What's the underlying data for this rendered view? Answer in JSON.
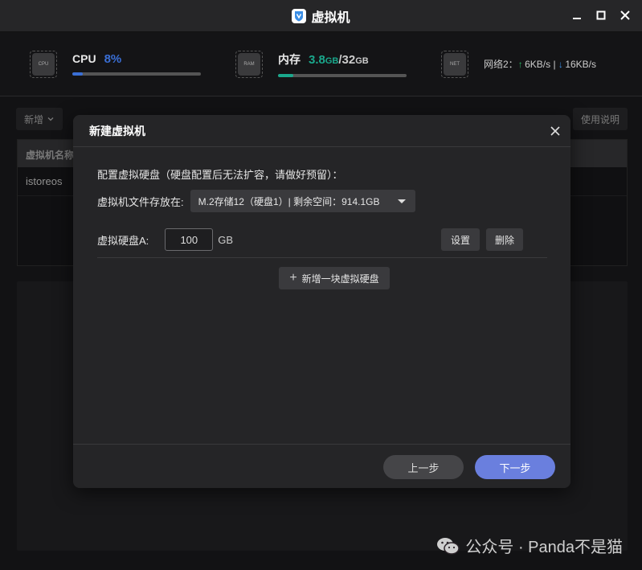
{
  "window": {
    "title": "虚拟机"
  },
  "stats": {
    "cpu": {
      "chip": "CPU",
      "label": "CPU",
      "value": "8%",
      "fraction": 0.08,
      "color": "#3a6fd6"
    },
    "mem": {
      "chip": "RAM",
      "label": "内存",
      "used": "3.8",
      "used_unit": "GB",
      "sep": "/",
      "total": "32",
      "total_unit": "GB",
      "fraction": 0.12,
      "color": "#1aa88c"
    },
    "net": {
      "chip": "NET",
      "label": "网络2：",
      "up_arrow": "↑",
      "up": "6KB/s",
      "sep": " | ",
      "down_arrow": "↓",
      "down": "16KB/s"
    }
  },
  "toolbar": {
    "new_label": "新增",
    "help_label": "使用说明"
  },
  "table": {
    "header_first": "虚拟机名称",
    "rows": [
      {
        "name": "istoreos"
      }
    ]
  },
  "dialog": {
    "title": "新建虚拟机",
    "intro": "配置虚拟硬盘（硬盘配置后无法扩容，请做好预留）：",
    "location_label": "虚拟机文件存放在:",
    "location_value": "M.2存储12（硬盘1）| 剩余空间：914.1GB",
    "disk_label": "虚拟硬盘A:",
    "disk_size": "100",
    "disk_unit": "GB",
    "settings_label": "设置",
    "delete_label": "删除",
    "add_disk_label": "新增一块虚拟硬盘",
    "prev_label": "上一步",
    "next_label": "下一步"
  },
  "watermark": {
    "text": "公众号 · Panda不是猫"
  }
}
